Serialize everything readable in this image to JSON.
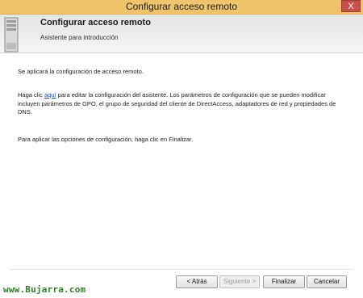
{
  "window": {
    "title": "Configurar acceso remoto",
    "close_glyph": "X"
  },
  "header": {
    "title": "Configurar acceso remoto",
    "subtitle": "Asistente para introducción",
    "icon": "server-icon"
  },
  "content": {
    "line1": "Se aplicará la configuración de acceso remoto.",
    "para2_prefix": "Haga clic ",
    "para2_link": "aquí",
    "para2_suffix": " para editar la configuración del asistente. Los parámetros de configuración que se pueden modificar incluyen parámetros de GPO, el grupo de seguridad del cliente de DirectAccess, adaptadores de red y propiedades de DNS.",
    "line3": "Para aplicar las opciones de configuración, haga clic en Finalizar."
  },
  "buttons": {
    "back": "< Atrás",
    "next": "Siguiente >",
    "finish": "Finalizar",
    "cancel": "Cancelar"
  },
  "watermark": "www.Bujarra.com",
  "colors": {
    "titlebar": "#efc26b",
    "close": "#c7504a",
    "link": "#1a4fa6",
    "watermark": "#2d7f28"
  }
}
